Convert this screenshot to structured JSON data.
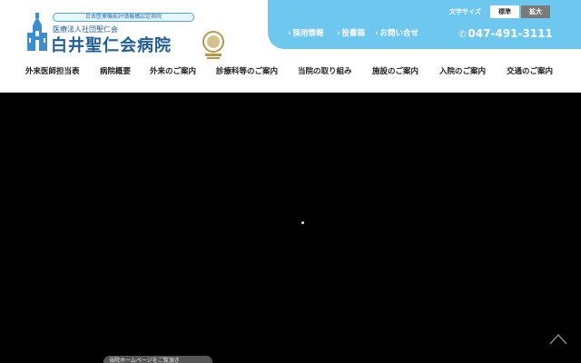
{
  "header": {
    "certification": "日本医療機能評価機構認定病院",
    "corporation": "医療法人社団聖仁会",
    "hospital_name": "白井聖仁会病院"
  },
  "utility": {
    "font_size_label": "文字サイズ",
    "font_standard": "標準",
    "font_large": "拡大",
    "links": [
      "採用情報",
      "投書箱",
      "お問い合せ"
    ],
    "phone": "047-491-3111"
  },
  "nav": {
    "items": [
      "外来医師担当表",
      "病院概要",
      "外来のご案内",
      "診療科等のご案内",
      "当院の取り組み",
      "施設のご案内",
      "入院のご案内",
      "交通のご案内"
    ]
  },
  "hero": {
    "pill_text": "当院ホームページをご覧頂き"
  },
  "colors": {
    "brand": "#1f5e96",
    "utility_bg": "#6ec7ee",
    "hero_bg": "#000000"
  }
}
